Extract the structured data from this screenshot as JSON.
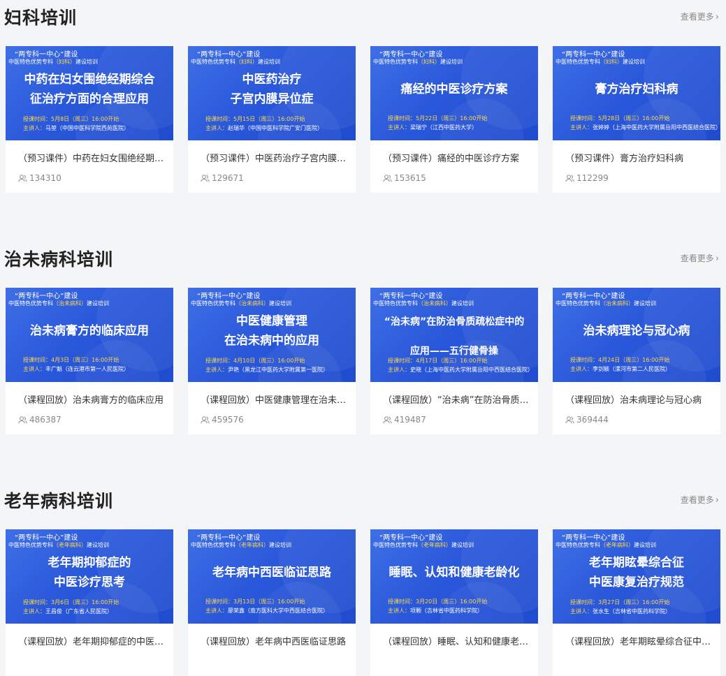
{
  "more_label": "查看更多",
  "accent_color": "#2a58da",
  "sections": [
    {
      "title": "妇科培训",
      "cards": [
        {
          "banner_top": "“两专科一中心”建设",
          "banner_program": "中医特色优势专科",
          "banner_spec": "（妇科）",
          "banner_suffix": "建设培训",
          "banner_title_1": "中药在妇女围绝经期综合",
          "banner_title_2": "征治疗方面的合理应用",
          "time": "授课时间：5月8日（周三）16:00开始",
          "speaker_label": "主讲人：",
          "speaker": "马堃（中国中医科学院西苑医院）",
          "title": "（预习课件）中药在妇女围绝经期综合征治疗方面的合理应用",
          "views": "134310"
        },
        {
          "banner_top": "“两专科一中心”建设",
          "banner_program": "中医特色优势专科",
          "banner_spec": "（妇科）",
          "banner_suffix": "建设培训",
          "banner_title_1": "中医药治疗",
          "banner_title_2": "子宫内膜异位症",
          "time": "授课时间：5月15日（周三）16:00开始",
          "speaker_label": "主讲人：",
          "speaker": "赵瑞华（中国中医科学院广安门医院）",
          "title": "（预习课件）中医药治疗子宫内膜异位症",
          "views": "129671"
        },
        {
          "banner_top": "“两专科一中心”建设",
          "banner_program": "中医特色优势专科",
          "banner_spec": "（妇科）",
          "banner_suffix": "建设培训",
          "banner_title_1": "痛经的中医诊疗方案",
          "banner_title_2": "",
          "time": "授课时间：5月22日（周三）16:00开始",
          "speaker_label": "主讲人：",
          "speaker": "梁瑞宁（江西中医药大学）",
          "title": "（预习课件）痛经的中医诊疗方案",
          "views": "153615"
        },
        {
          "banner_top": "“两专科一中心”建设",
          "banner_program": "中医特色优势专科",
          "banner_spec": "（妇科）",
          "banner_suffix": "建设培训",
          "banner_title_1": "膏方治疗妇科病",
          "banner_title_2": "",
          "time": "授课时间：5月28日（周三）16:00开始",
          "speaker_label": "主讲人：",
          "speaker": "张婷婷（上海中医药大学附属岳阳中西医结合医院）",
          "title": "（预习课件）膏方治疗妇科病",
          "views": "112299"
        }
      ]
    },
    {
      "title": "治未病科培训",
      "cards": [
        {
          "banner_top": "“两专科一中心”建设",
          "banner_program": "中医特色优势专科",
          "banner_spec": "（治未病科）",
          "banner_suffix": "建设培训",
          "banner_title_1": "治未病膏方的临床应用",
          "banner_title_2": "",
          "time": "授课时间：4月3日（周三）16:00开始",
          "speaker_label": "主讲人：",
          "speaker": "丰广魁（连云港市第一人民医院）",
          "title": "（课程回放）治未病膏方的临床应用",
          "views": "486387"
        },
        {
          "banner_top": "“两专科一中心”建设",
          "banner_program": "中医特色优势专科",
          "banner_spec": "（治未病科）",
          "banner_suffix": "建设培训",
          "banner_title_1": "中医健康管理",
          "banner_title_2": "在治未病中的应用",
          "time": "授课时间：4月10日（周三）16:00开始",
          "speaker_label": "主讲人：",
          "speaker": "尹艳（黑龙江中医药大学附属第一医院）",
          "title": "（课程回放）中医健康管理在治未病中的应用",
          "views": "459576"
        },
        {
          "banner_top": "“两专科一中心”建设",
          "banner_program": "中医特色优势专科",
          "banner_spec": "（治未病科）",
          "banner_suffix": "建设培训",
          "banner_title_1": "“治未病”在防治骨质疏松症中的",
          "banner_title_2": "应用——五行健骨操",
          "time": "授课时间：4月17日（周三）16:00开始",
          "speaker_label": "主讲人：",
          "speaker": "史晓（上海中医药大学附属岳阳中西医结合医院）",
          "title": "（课程回放）“治未病”在防治骨质疏松症中的应用——五行健骨操",
          "views": "419487"
        },
        {
          "banner_top": "“两专科一中心”建设",
          "banner_program": "中医特色优势专科",
          "banner_spec": "（治未病科）",
          "banner_suffix": "建设培训",
          "banner_title_1": "治未病理论与冠心病",
          "banner_title_2": "",
          "time": "授课时间：4月24日（周三）16:00开始",
          "speaker_label": "主讲人：",
          "speaker": "李剑颖（漯河市第二人民医院）",
          "title": "（课程回放）治未病理论与冠心病",
          "views": "369444"
        }
      ]
    },
    {
      "title": "老年病科培训",
      "cards": [
        {
          "banner_top": "“两专科一中心”建设",
          "banner_program": "中医特色优势专科",
          "banner_spec": "（老年病科）",
          "banner_suffix": "建设培训",
          "banner_title_1": "老年期抑郁症的",
          "banner_title_2": "中医诊疗思考",
          "time": "授课时间：3月6日（周三）16:00开始",
          "speaker_label": "主讲人：",
          "speaker": "王昌俊（广东省人民医院）",
          "title": "（课程回放）老年期抑郁症的中医诊疗思考",
          "views": ""
        },
        {
          "banner_top": "“两专科一中心”建设",
          "banner_program": "中医特色优势专科",
          "banner_spec": "（老年病科）",
          "banner_suffix": "建设培训",
          "banner_title_1": "老年病中西医临证思路",
          "banner_title_2": "",
          "time": "授课时间：3月13日（周三）16:00开始",
          "speaker_label": "主讲人：",
          "speaker": "廖荣鑫（南方医科大学中西医结合医院）",
          "title": "（课程回放）老年病中西医临证思路",
          "views": ""
        },
        {
          "banner_top": "“两专科一中心”建设",
          "banner_program": "中医特色优势专科",
          "banner_spec": "（老年病科）",
          "banner_suffix": "建设培训",
          "banner_title_1": "睡眠、认知和健康老龄化",
          "banner_title_2": "",
          "time": "授课时间：3月20日（周三）16:00开始",
          "speaker_label": "主讲人：",
          "speaker": "项颗（吉林省中医药科学院）",
          "title": "（课程回放）睡眠、认知和健康老龄化",
          "views": ""
        },
        {
          "banner_top": "“两专科一中心”建设",
          "banner_program": "中医特色优势专科",
          "banner_spec": "（老年病科）",
          "banner_suffix": "建设培训",
          "banner_title_1": "老年期眩晕综合征",
          "banner_title_2": "中医康复治疗规范",
          "time": "授课时间：3月27日（周三）16:00开始",
          "speaker_label": "主讲人：",
          "speaker": "张水生（吉林省中医药科学院）",
          "title": "（课程回放）老年期眩晕综合征中医康复治疗规范",
          "views": ""
        }
      ]
    }
  ]
}
